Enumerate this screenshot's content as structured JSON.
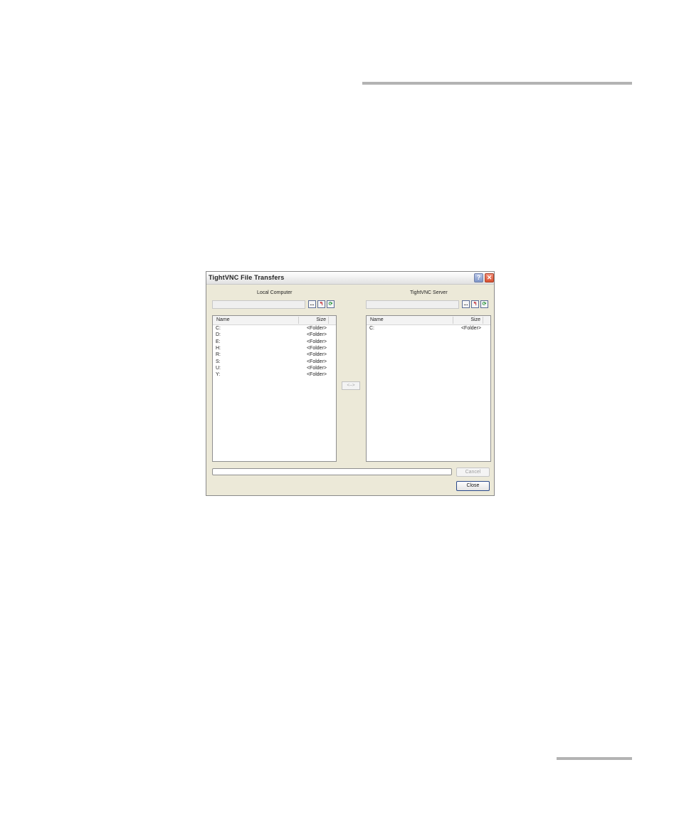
{
  "window": {
    "title": "TightVNC File Transfers",
    "help_glyph": "?",
    "close_glyph": "✕"
  },
  "local": {
    "caption": "Local Computer",
    "path_value": "",
    "browse_label": "...",
    "up_glyph": "↰",
    "refresh_glyph": "⟳",
    "columns": {
      "name": "Name",
      "size": "Size"
    },
    "rows": [
      {
        "name": "C:",
        "size": "<Folder>"
      },
      {
        "name": "D:",
        "size": "<Folder>"
      },
      {
        "name": "E:",
        "size": "<Folder>"
      },
      {
        "name": "H:",
        "size": "<Folder>"
      },
      {
        "name": "R:",
        "size": "<Folder>"
      },
      {
        "name": "S:",
        "size": "<Folder>"
      },
      {
        "name": "U:",
        "size": "<Folder>"
      },
      {
        "name": "Y:",
        "size": "<Folder>"
      }
    ]
  },
  "remote": {
    "caption": "TightVNC Server",
    "path_value": "",
    "browse_label": "...",
    "up_glyph": "↰",
    "refresh_glyph": "⟳",
    "columns": {
      "name": "Name",
      "size": "Size"
    },
    "rows": [
      {
        "name": "C:",
        "size": "<Folder>"
      }
    ]
  },
  "transfer_label": "<-->",
  "progress": {
    "fraction": 0
  },
  "buttons": {
    "cancel": "Cancel",
    "close": "Close"
  }
}
